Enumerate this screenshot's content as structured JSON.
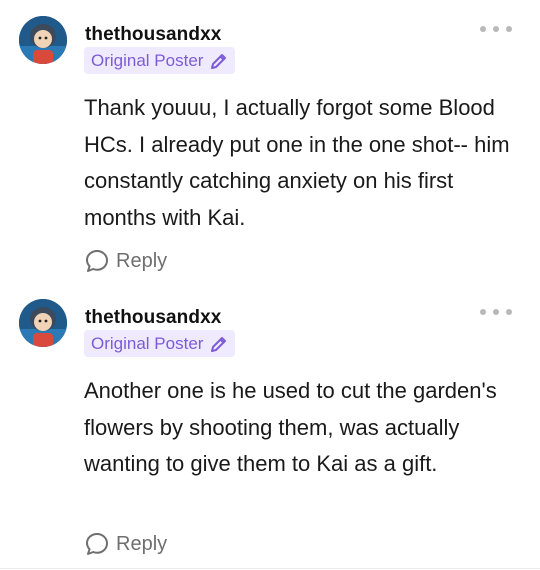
{
  "comments": [
    {
      "username": "thethousandxx",
      "badge_label": "Original Poster",
      "text": "Thank youuu, I actually forgot some Blood HCs. I already put one in the one shot-- him constantly catching anxiety on his first months with Kai.",
      "reply_label": "Reply"
    },
    {
      "username": "thethousandxx",
      "badge_label": "Original Poster",
      "text": "Another one is he used to cut the garden's flowers by shooting them, was actually wanting to give them to Kai as a gift.",
      "reply_label": "Reply"
    }
  ],
  "colors": {
    "badge_bg": "#efeafd",
    "badge_text": "#7c5cd6",
    "reply_text": "#6f6f6f",
    "more_dots": "#b9b9b9"
  },
  "icons": {
    "badge": "pencil-icon",
    "reply": "speech-bubble-icon",
    "more": "more-options-icon"
  }
}
